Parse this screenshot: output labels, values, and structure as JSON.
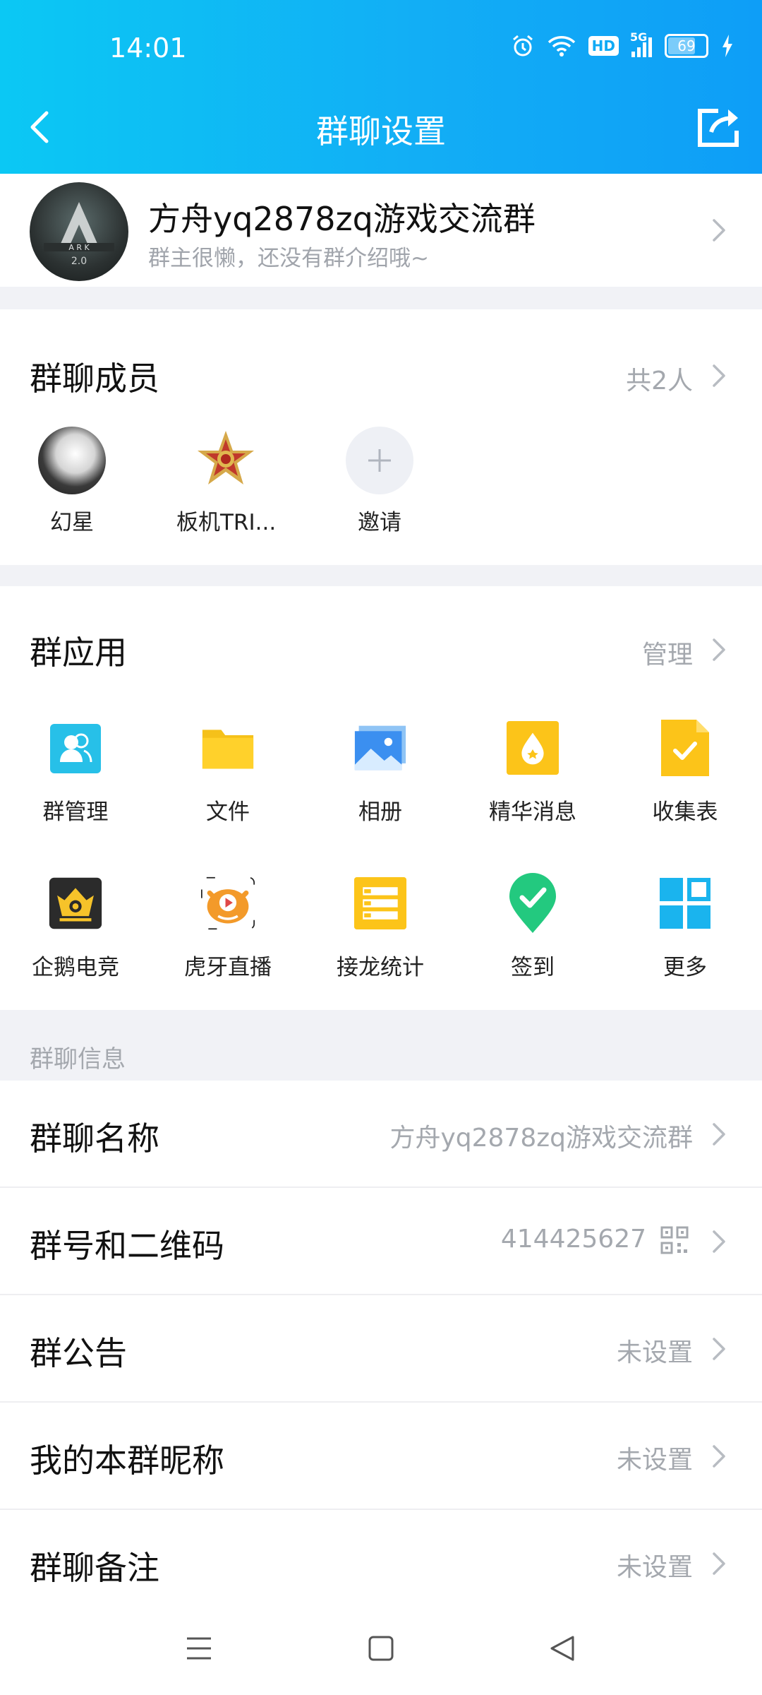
{
  "status_bar": {
    "time": "14:01",
    "hd": "HD",
    "signal": "5G",
    "battery": "69"
  },
  "nav": {
    "title": "群聊设置"
  },
  "group": {
    "name": "方舟yq2878zq游戏交流群",
    "description": "群主很懒，还没有群介绍哦~"
  },
  "members": {
    "title": "群聊成员",
    "count": "共2人",
    "items": [
      {
        "name": "幻星"
      },
      {
        "name": "板机TRI..."
      },
      {
        "name": "邀请"
      }
    ]
  },
  "apps": {
    "title": "群应用",
    "manage": "管理",
    "items": [
      {
        "label": "群管理",
        "icon": "group-manage-icon"
      },
      {
        "label": "文件",
        "icon": "folder-icon"
      },
      {
        "label": "相册",
        "icon": "album-icon"
      },
      {
        "label": "精华消息",
        "icon": "essence-icon"
      },
      {
        "label": "收集表",
        "icon": "form-icon"
      },
      {
        "label": "企鹅电竞",
        "icon": "esports-icon"
      },
      {
        "label": "虎牙直播",
        "icon": "huya-icon"
      },
      {
        "label": "接龙统计",
        "icon": "relay-icon"
      },
      {
        "label": "签到",
        "icon": "checkin-icon"
      },
      {
        "label": "更多",
        "icon": "more-grid-icon"
      }
    ]
  },
  "info": {
    "title": "群聊信息",
    "rows": [
      {
        "label": "群聊名称",
        "value": "方舟yq2878zq游戏交流群"
      },
      {
        "label": "群号和二维码",
        "value": "414425627"
      },
      {
        "label": "群公告",
        "value": "未设置"
      },
      {
        "label": "我的本群昵称",
        "value": "未设置"
      },
      {
        "label": "群聊备注",
        "value": "未设置"
      }
    ]
  },
  "colors": {
    "header_start": "#0bc8f4",
    "header_end": "#0e9ef7",
    "muted": "#a4a8ae"
  }
}
